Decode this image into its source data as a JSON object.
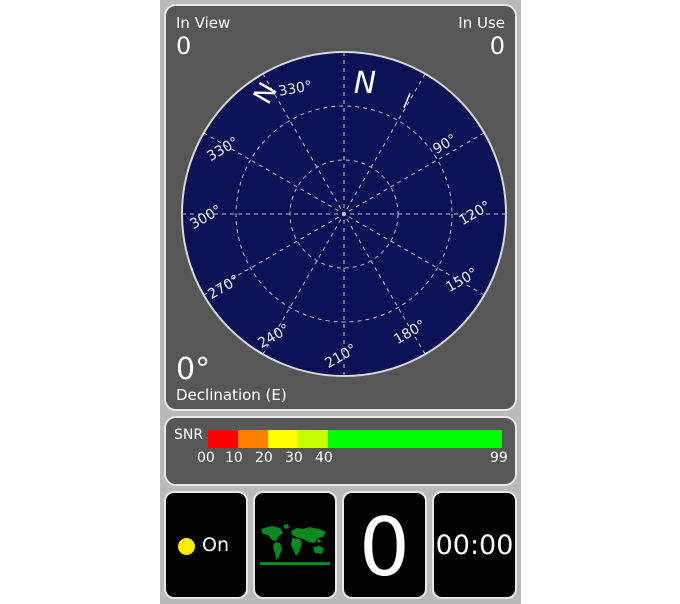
{
  "sky": {
    "in_view_label": "In View",
    "in_view_value": "0",
    "in_use_label": "In Use",
    "in_use_value": "0",
    "declination_value": "0°",
    "declination_label": "Declination (E)",
    "north_label": "N",
    "bearing_labels": [
      "330°",
      "90°",
      "330°",
      "120°",
      "300°",
      "150°",
      "270°",
      "180°",
      "240°",
      "210°"
    ]
  },
  "snr": {
    "label": "SNR",
    "ticks": [
      "00",
      "10",
      "20",
      "30",
      "40",
      "99"
    ],
    "colors": [
      "#ff0000",
      "#ff8000",
      "#ffff00",
      "#c8ff00",
      "#00ff00"
    ]
  },
  "status": {
    "label": "On",
    "dot_color": "#ffee00"
  },
  "count": {
    "value": "0"
  },
  "timer": {
    "value": "00:00"
  },
  "colors": {
    "sky_bg": "#0b1255",
    "panel_bg": "#575757",
    "map_green": "#0b8a22"
  }
}
